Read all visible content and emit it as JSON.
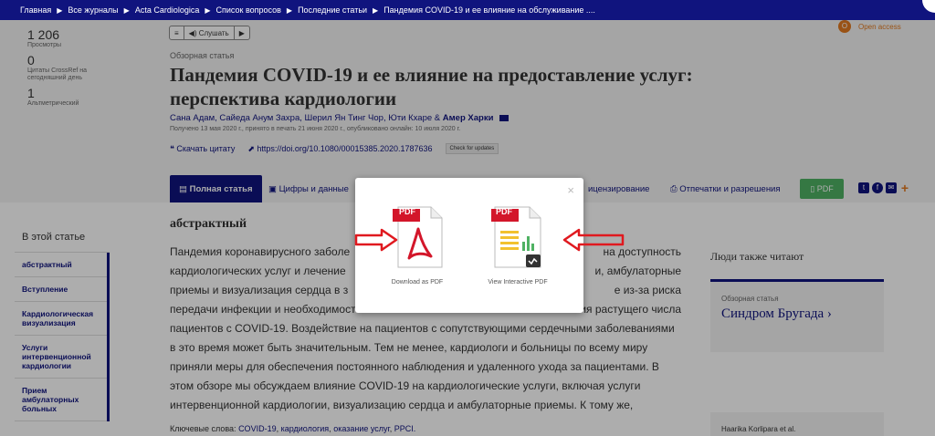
{
  "breadcrumb": [
    "Главная",
    "Все журналы",
    "Acta Cardiologica",
    "Список вопросов",
    "Последние статьи",
    "Пандемия COVID-19 и ее влияние на обслуживание ...."
  ],
  "metrics": [
    {
      "value": "1 206",
      "label": "Просмотры"
    },
    {
      "value": "0",
      "label": "Цитаты CrossRef на сегодняшний день"
    },
    {
      "value": "1",
      "label": "Альтметрический"
    }
  ],
  "listen_label": "Слушать",
  "open_access": "Open access",
  "article_type": "Обзорная статья",
  "title": "Пандемия COVID-19 и ее влияние на предоставление услуг: перспектива кардиологии",
  "authors_plain": "Сана Адам, Сайеда Анум Захра, Шерил Ян Тинг Чор, Юти Кхаре &",
  "author_bold": "Амер Харки",
  "dates": "Получено 13 мая 2020 г., принято в печать 21 июня 2020 г., опубликовано онлайн: 10 июля 2020 г.",
  "cite_label": "Скачать цитату",
  "doi": "https://doi.org/10.1080/00015385.2020.1787636",
  "check_updates": "Check for updates",
  "tabs": {
    "full": "Полная статья",
    "figures": "Цифры и данные",
    "licensing": "ицензирование",
    "reprints": "Отпечатки и разрешения",
    "pdf": "PDF"
  },
  "toc": {
    "title": "В этой статье",
    "items": [
      "абстрактный",
      "Вступление",
      "Кардиологическая визуализация",
      "Услуги интервенционной кардиологии",
      "Прием амбулаторных больных"
    ]
  },
  "abstract_title": "абстрактный",
  "abstract_lines": [
    {
      "left": "Пандемия коронавирусного заболе",
      "right": "на доступность"
    },
    {
      "left": "кардиологических услуг и лечение",
      "right": "и, амбулаторные"
    },
    {
      "left": "приемы и визуализация сердца в з",
      "right": "е из-за риска"
    },
    {
      "left": "передачи инфекции и необходимост",
      "right": "ения растущего числа"
    },
    {
      "left": "пациентов с COVID-19. Воздействие на пациентов с сопутствующими сердечными заболеваниями",
      "right": ""
    },
    {
      "left": "в это время может быть значительным. Тем не менее, кардиологи и больницы по всему миру",
      "right": ""
    },
    {
      "left": "приняли меры для обеспечения постоянного наблюдения и удаленного ухода за пациентами. В",
      "right": ""
    },
    {
      "left": "этом обзоре мы обсуждаем влияние COVID-19 на кардиологические услуги, включая услуги",
      "right": ""
    },
    {
      "left": "интервенционной кардиологии, визуализацию сердца и амбулаторные приемы. К тому же,",
      "right": ""
    }
  ],
  "keywords_label": "Ключевые слова:",
  "keywords": [
    "COVID-19",
    "кардиология",
    "оказание услуг",
    "PPCI."
  ],
  "also_reading": "Люди также читают",
  "related": {
    "type": "Обзорная статья",
    "title": "Синдром Бругада"
  },
  "related2_authors": "Haarika Korlipara et al.",
  "modal": {
    "close": "×",
    "options": [
      {
        "label": "Download as PDF",
        "badge": "PDF"
      },
      {
        "label": "View Interactive PDF",
        "badge": "PDF"
      }
    ]
  },
  "colors": {
    "navy": "#10147e",
    "orange": "#e27a1f",
    "pdf_red": "#d3162a",
    "arrow_red": "#e0191f",
    "green": "#4fb263"
  }
}
